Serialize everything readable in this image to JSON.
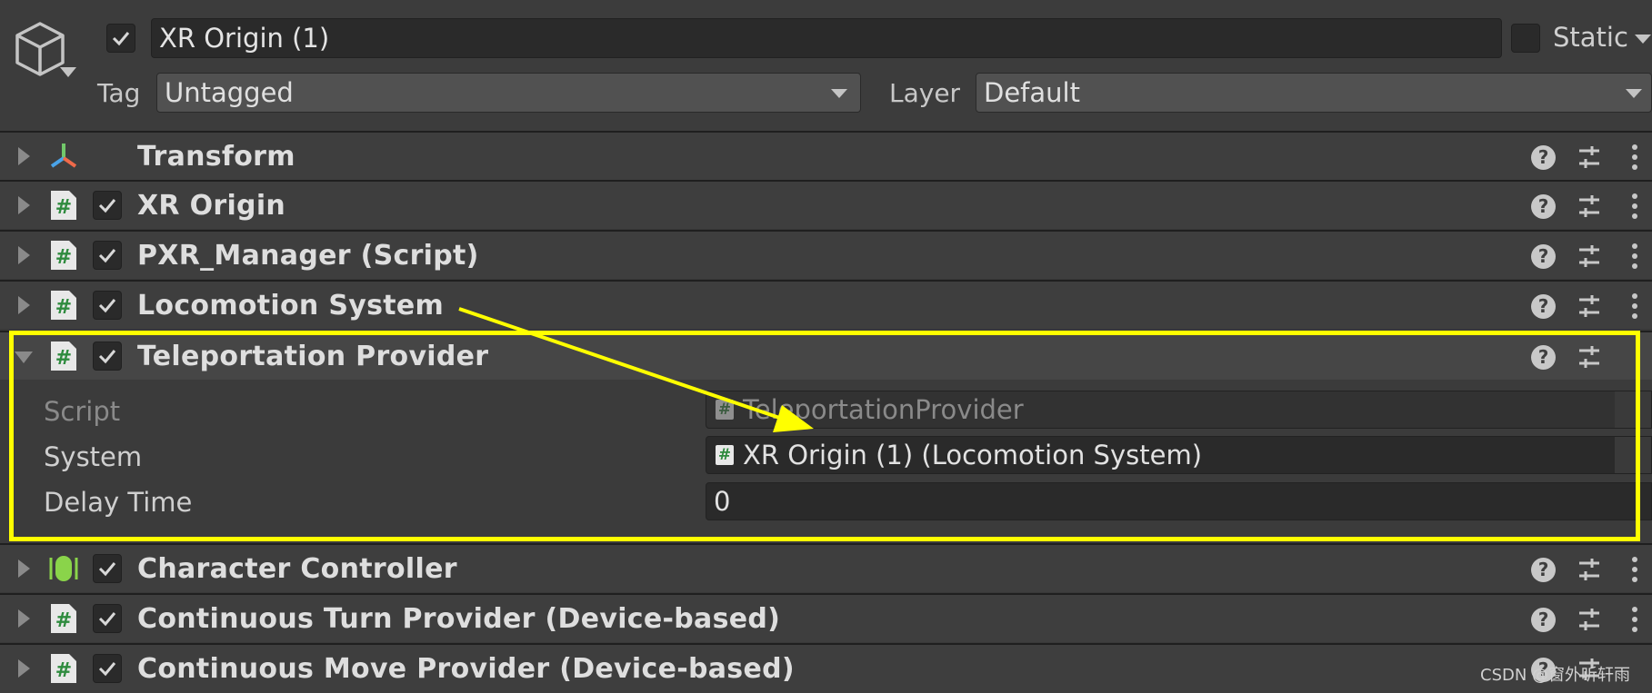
{
  "header": {
    "object_name": "XR Origin (1)",
    "static_label": "Static",
    "tag_label": "Tag",
    "tag_value": "Untagged",
    "layer_label": "Layer",
    "layer_value": "Default"
  },
  "components": [
    {
      "title": "Transform",
      "icon": "transform-icon",
      "enabled": null,
      "expanded": false
    },
    {
      "title": "XR Origin",
      "icon": "script-icon",
      "enabled": true,
      "expanded": false
    },
    {
      "title": "PXR_Manager (Script)",
      "icon": "script-icon",
      "enabled": true,
      "expanded": false
    },
    {
      "title": "Locomotion System",
      "icon": "script-icon",
      "enabled": true,
      "expanded": false
    },
    {
      "title": "Teleportation Provider",
      "icon": "script-icon",
      "enabled": true,
      "expanded": true
    },
    {
      "title": "Character Controller",
      "icon": "character-controller-icon",
      "enabled": true,
      "expanded": false
    },
    {
      "title": "Continuous Turn Provider (Device-based)",
      "icon": "script-icon",
      "enabled": true,
      "expanded": false
    },
    {
      "title": "Continuous Move Provider (Device-based)",
      "icon": "script-icon",
      "enabled": true,
      "expanded": false
    }
  ],
  "teleportation_provider": {
    "script_label": "Script",
    "script_value": "TeleportationProvider",
    "system_label": "System",
    "system_value": "XR Origin (1) (Locomotion System)",
    "delay_label": "Delay Time",
    "delay_value": "0"
  },
  "icons": {
    "help": "?",
    "script_hash": "#"
  },
  "annotation_color": "#ffff00",
  "watermark": "CSDN @窗外听轩雨"
}
